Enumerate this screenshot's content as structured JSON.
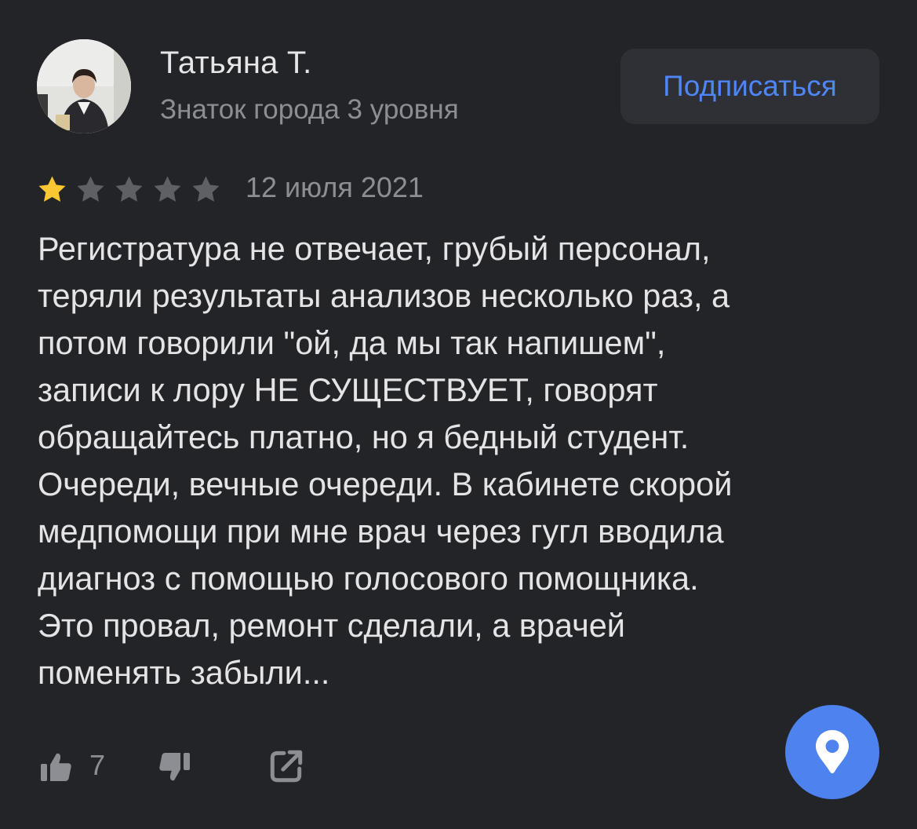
{
  "author": {
    "name": "Татьяна Т.",
    "level": "Знаток города 3 уровня",
    "avatar_icon": "user-photo"
  },
  "subscribe_label": "Подписаться",
  "review": {
    "rating": 1,
    "max_rating": 5,
    "date": "12 июля 2021",
    "text": "Регистратура не отвечает, грубый персонал,\nтеряли результаты анализов несколько раз, а\nпотом говорили \"ой, да мы так напишем\",\nзаписи к лору НЕ СУЩЕСТВУЕТ, говорят\nобращайтесь платно, но я бедный студент.\nОчереди, вечные очереди. В кабинете скорой\nмедпомощи при мне врач через гугл вводила\nдиагноз с помощью голосового помощника.\nЭто провал, ремонт сделали, а врачей\nпоменять забыли..."
  },
  "actions": {
    "like_count": "7",
    "like_icon": "thumbs-up-icon",
    "dislike_icon": "thumbs-down-icon",
    "share_icon": "share-icon"
  },
  "fab_icon": "map-pin-icon",
  "colors": {
    "background": "#232428",
    "accent": "#4f86f7",
    "star_filled": "#f9c731",
    "star_empty": "#5f6064",
    "muted_text": "#8d8e93"
  }
}
